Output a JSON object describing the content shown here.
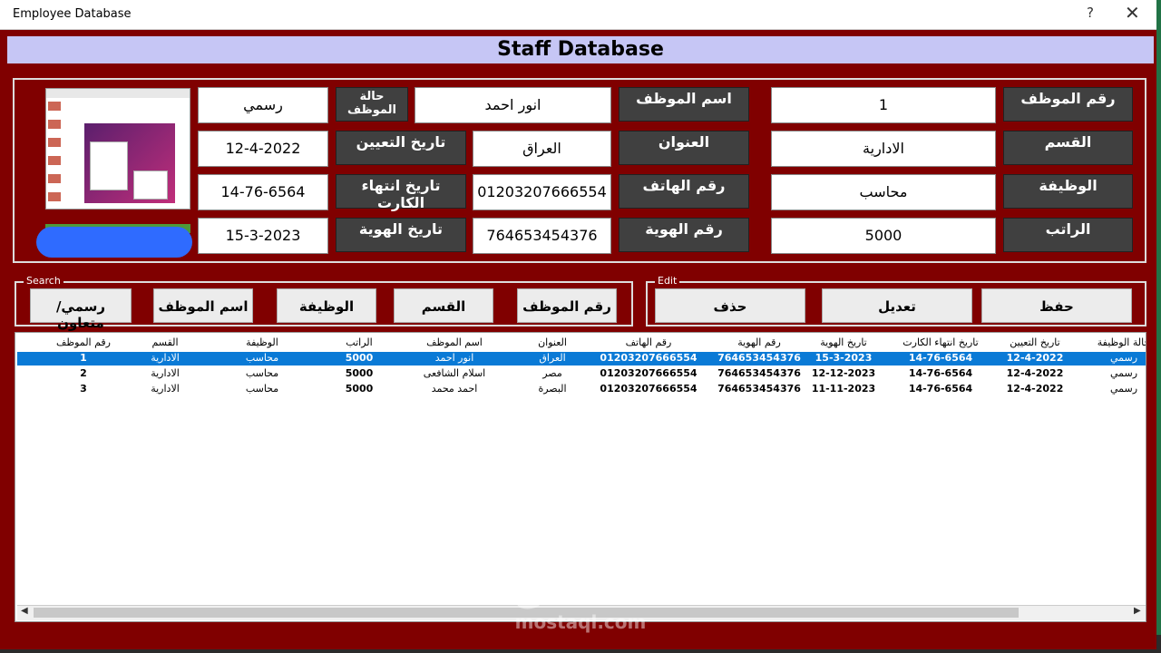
{
  "window": {
    "title": "Employee Database",
    "help": "?",
    "close": "✕"
  },
  "header": {
    "title": "Staff Database"
  },
  "form": {
    "emp_id_label": "رقم الموظف",
    "emp_id_value": "1",
    "emp_name_label": "اسم الموظف",
    "emp_name_value": "انور احمد",
    "status_label": "حالة الموظف",
    "status_value": "رسمي",
    "dept_label": "القسم",
    "dept_value": "الادارية",
    "address_label": "العنوان",
    "address_value": "العراق",
    "hire_label": "تاريخ التعيين",
    "hire_value": "12-4-2022",
    "job_label": "الوظيفة",
    "job_value": "محاسب",
    "phone_label": "رقم الهاتف",
    "phone_value": "01203207666554",
    "card_end_label": "تاريخ انتهاء الكارت",
    "card_end_value": "14-76-6564",
    "salary_label": "الراتب",
    "salary_value": "5000",
    "idnum_label": "رقم الهوية",
    "idnum_value": "764653454376",
    "iddate_label": "تاريخ الهوية",
    "iddate_value": "15-3-2023"
  },
  "search": {
    "group_label": "Search",
    "buttons": [
      "رقم الموظف",
      "القسم",
      "الوظيفة",
      "اسم الموظف",
      "رسمي/ متعاون"
    ]
  },
  "edit": {
    "group_label": "Edit",
    "buttons": [
      "حفظ",
      "تعديل",
      "حذف"
    ]
  },
  "table": {
    "headers": [
      "رقم الموظف",
      "القسم",
      "الوظيفة",
      "الراتب",
      "اسم الموظف",
      "العنوان",
      "رقم الهاتف",
      "رقم الهوية",
      "تاريخ الهوية",
      "تاريخ انتهاء الكارت",
      "تاريخ التعيين",
      "حالة الوظيفة"
    ],
    "rows": [
      [
        "1",
        "الادارية",
        "محاسب",
        "5000",
        "انور احمد",
        "العراق",
        "01203207666554",
        "764653454376",
        "15-3-2023",
        "14-76-6564",
        "12-4-2022",
        "رسمي"
      ],
      [
        "2",
        "الادارية",
        "محاسب",
        "5000",
        "اسلام الشافعى",
        "مصر",
        "01203207666554",
        "764653454376",
        "12-12-2023",
        "14-76-6564",
        "12-4-2022",
        "رسمي"
      ],
      [
        "3",
        "الادارية",
        "محاسب",
        "5000",
        "احمد محمد",
        "البصرة",
        "01203207666554",
        "764653454376",
        "11-11-2023",
        "14-76-6564",
        "12-4-2022",
        "رسمي"
      ]
    ],
    "scroll_left": "◀",
    "scroll_right": "▶"
  },
  "watermark": {
    "arabic": "مستقل",
    "latin": "mostaql.com"
  }
}
